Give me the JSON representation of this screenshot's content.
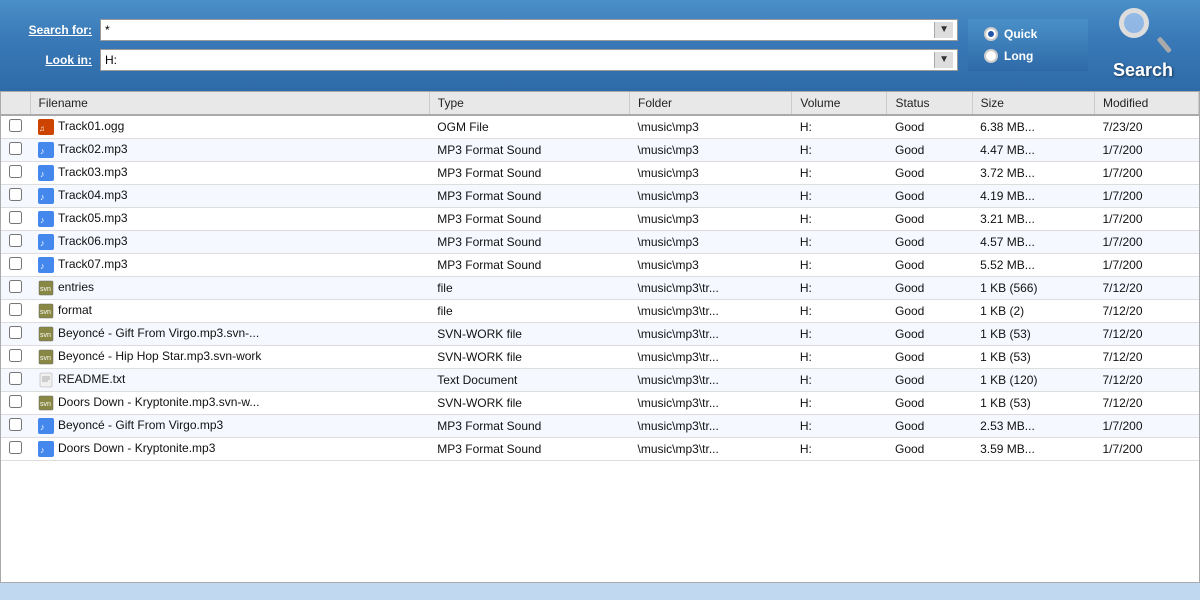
{
  "header": {
    "search_for_label": "Search for:",
    "look_in_label": "Look in:",
    "search_for_value": "*",
    "look_in_value": "H:",
    "quick_label": "Quick",
    "long_label": "Long",
    "search_button_label": "Search",
    "quick_selected": true
  },
  "table": {
    "columns": [
      "Filename",
      "Type",
      "Folder",
      "Volume",
      "Status",
      "Size",
      "Modified"
    ],
    "rows": [
      {
        "filename": "Track01.ogg",
        "type": "OGM File",
        "folder": "\\music\\mp3",
        "volume": "H:",
        "status": "Good",
        "size": "6.38 MB...",
        "modified": "7/23/20",
        "icon": "ogg"
      },
      {
        "filename": "Track02.mp3",
        "type": "MP3 Format Sound",
        "folder": "\\music\\mp3",
        "volume": "H:",
        "status": "Good",
        "size": "4.47 MB...",
        "modified": "1/7/200",
        "icon": "mp3"
      },
      {
        "filename": "Track03.mp3",
        "type": "MP3 Format Sound",
        "folder": "\\music\\mp3",
        "volume": "H:",
        "status": "Good",
        "size": "3.72 MB...",
        "modified": "1/7/200",
        "icon": "mp3"
      },
      {
        "filename": "Track04.mp3",
        "type": "MP3 Format Sound",
        "folder": "\\music\\mp3",
        "volume": "H:",
        "status": "Good",
        "size": "4.19 MB...",
        "modified": "1/7/200",
        "icon": "mp3"
      },
      {
        "filename": "Track05.mp3",
        "type": "MP3 Format Sound",
        "folder": "\\music\\mp3",
        "volume": "H:",
        "status": "Good",
        "size": "3.21 MB...",
        "modified": "1/7/200",
        "icon": "mp3"
      },
      {
        "filename": "Track06.mp3",
        "type": "MP3 Format Sound",
        "folder": "\\music\\mp3",
        "volume": "H:",
        "status": "Good",
        "size": "4.57 MB...",
        "modified": "1/7/200",
        "icon": "mp3"
      },
      {
        "filename": "Track07.mp3",
        "type": "MP3 Format Sound",
        "folder": "\\music\\mp3",
        "volume": "H:",
        "status": "Good",
        "size": "5.52 MB...",
        "modified": "1/7/200",
        "icon": "mp3"
      },
      {
        "filename": "entries",
        "type": "file",
        "folder": "\\music\\mp3\\tr...",
        "volume": "H:",
        "status": "Good",
        "size": "1 KB (566)",
        "modified": "7/12/20",
        "icon": "svn"
      },
      {
        "filename": "format",
        "type": "file",
        "folder": "\\music\\mp3\\tr...",
        "volume": "H:",
        "status": "Good",
        "size": "1 KB (2)",
        "modified": "7/12/20",
        "icon": "svn"
      },
      {
        "filename": "Beyoncé - Gift From Virgo.mp3.svn-...",
        "type": "SVN-WORK file",
        "folder": "\\music\\mp3\\tr...",
        "volume": "H:",
        "status": "Good",
        "size": "1 KB (53)",
        "modified": "7/12/20",
        "icon": "svn"
      },
      {
        "filename": "Beyoncé - Hip Hop Star.mp3.svn-work",
        "type": "SVN-WORK file",
        "folder": "\\music\\mp3\\tr...",
        "volume": "H:",
        "status": "Good",
        "size": "1 KB (53)",
        "modified": "7/12/20",
        "icon": "svn"
      },
      {
        "filename": "README.txt",
        "type": "Text Document",
        "folder": "\\music\\mp3\\tr...",
        "volume": "H:",
        "status": "Good",
        "size": "1 KB (120)",
        "modified": "7/12/20",
        "icon": "txt"
      },
      {
        "filename": "Doors Down - Kryptonite.mp3.svn-w...",
        "type": "SVN-WORK file",
        "folder": "\\music\\mp3\\tr...",
        "volume": "H:",
        "status": "Good",
        "size": "1 KB (53)",
        "modified": "7/12/20",
        "icon": "svn"
      },
      {
        "filename": "Beyoncé - Gift From Virgo.mp3",
        "type": "MP3 Format Sound",
        "folder": "\\music\\mp3\\tr...",
        "volume": "H:",
        "status": "Good",
        "size": "2.53 MB...",
        "modified": "1/7/200",
        "icon": "mp3"
      },
      {
        "filename": "Doors Down - Kryptonite.mp3",
        "type": "MP3 Format Sound",
        "folder": "\\music\\mp3\\tr...",
        "volume": "H:",
        "status": "Good",
        "size": "3.59 MB...",
        "modified": "1/7/200",
        "icon": "mp3"
      }
    ]
  }
}
